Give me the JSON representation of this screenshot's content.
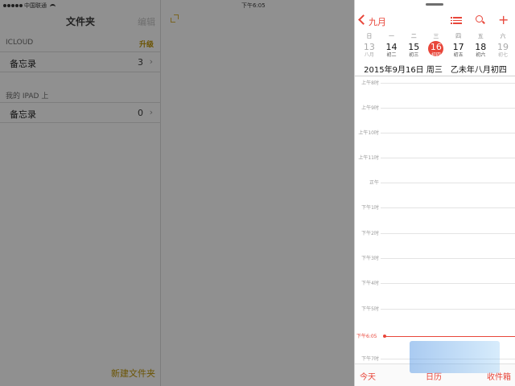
{
  "status_bar": {
    "carrier": "中国联通",
    "time": "下午6:05"
  },
  "notes": {
    "title": "文件夹",
    "edit_label": "编辑",
    "sections": [
      {
        "label": "ICLOUD",
        "action": "升级",
        "folders": [
          {
            "name": "备忘录",
            "count": "3"
          }
        ]
      },
      {
        "label": "我的 IPAD 上",
        "folders": [
          {
            "name": "备忘录",
            "count": "0"
          }
        ]
      }
    ],
    "new_folder_label": "新建文件夹"
  },
  "calendar": {
    "month_back_label": "九月",
    "weekdays": [
      "日",
      "一",
      "二",
      "三",
      "四",
      "五",
      "六"
    ],
    "days": [
      {
        "number": "13",
        "lunar": "八月"
      },
      {
        "number": "14",
        "lunar": "初二"
      },
      {
        "number": "15",
        "lunar": "初三"
      },
      {
        "number": "16",
        "lunar": "初四",
        "selected": true
      },
      {
        "number": "17",
        "lunar": "初五"
      },
      {
        "number": "18",
        "lunar": "初六"
      },
      {
        "number": "19",
        "lunar": "初七"
      }
    ],
    "selected_date_text": "2015年9月16日 周三　乙未年八月初四",
    "hours": [
      "上午8时",
      "上午9时",
      "上午10时",
      "上午11时",
      "正午",
      "下午1时",
      "下午2时",
      "下午3时",
      "下午4时",
      "下午5时",
      "下午7时"
    ],
    "now_label": "下午6:05",
    "toolbar": {
      "today": "今天",
      "calendars": "日历",
      "inbox": "收件箱"
    }
  },
  "colors": {
    "accent_red": "#e8463a",
    "notes_accent": "#6b5300",
    "dim_overlay": "#909090"
  }
}
